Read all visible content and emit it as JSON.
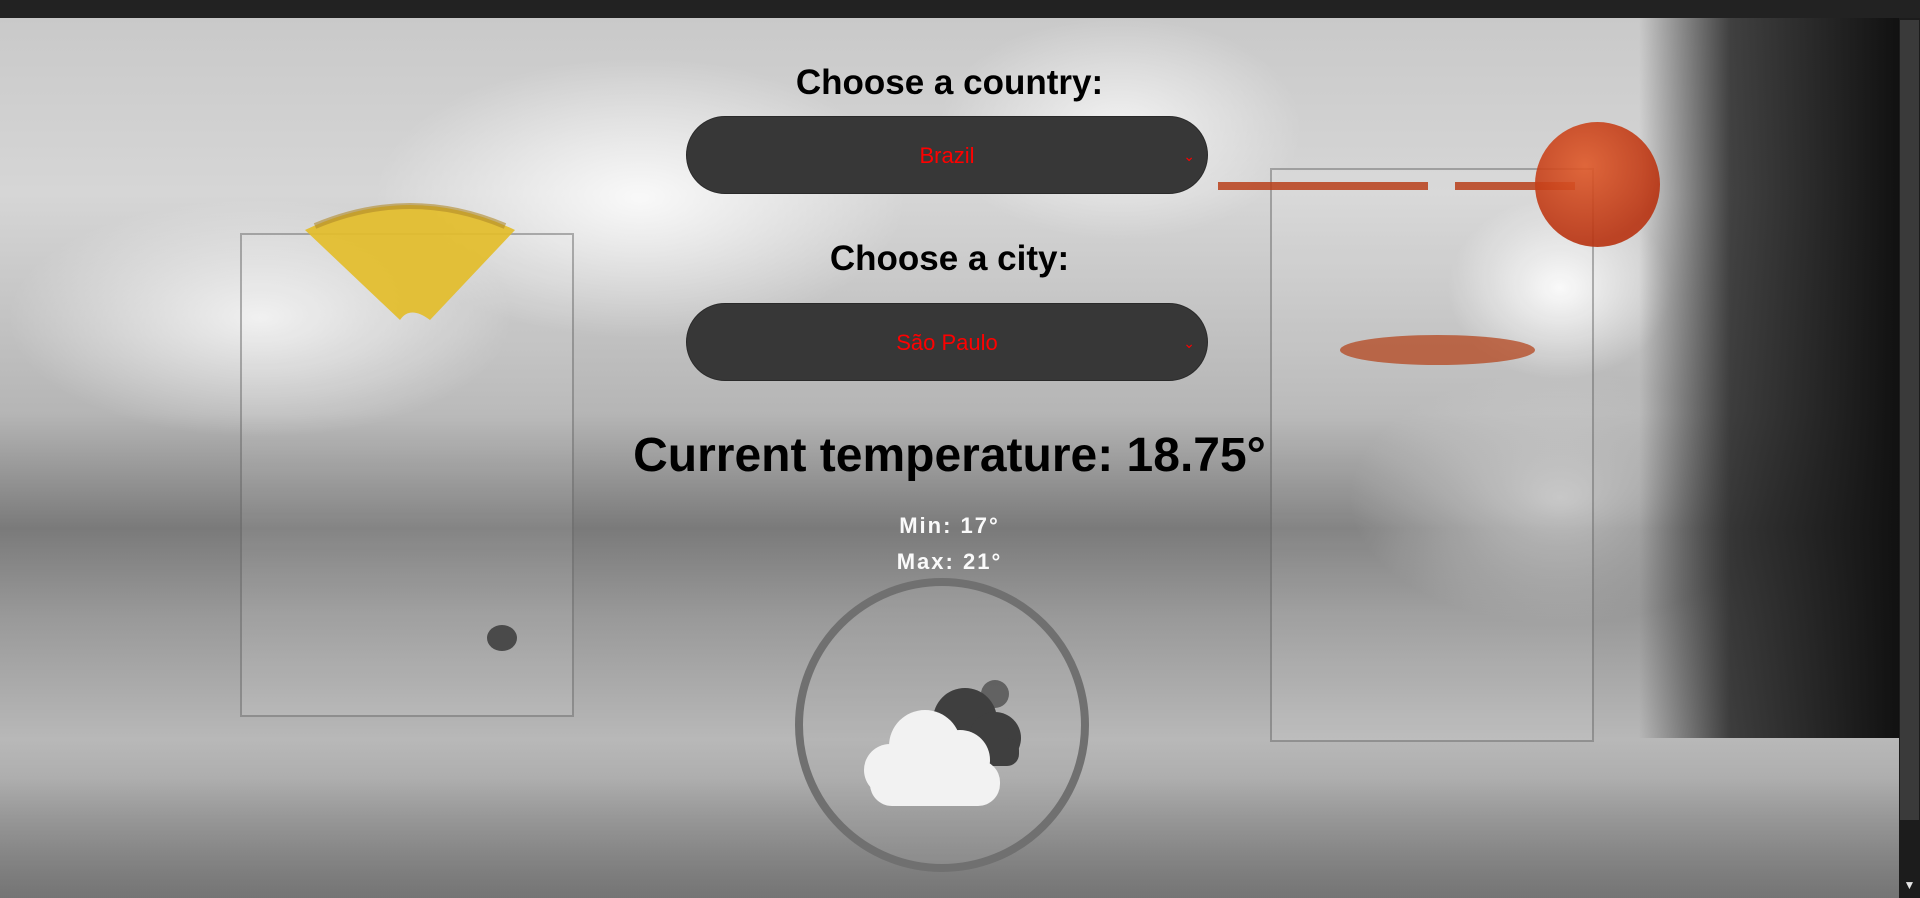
{
  "country": {
    "label": "Choose a country:",
    "selected": "Brazil"
  },
  "city": {
    "label": "Choose a city:",
    "selected": "São Paulo"
  },
  "temperature": {
    "current_text": "Current temperature: 18.75°",
    "min_text": "Min: 17°",
    "max_text": "Max: 21°"
  },
  "weather_icon": "partly-cloudy-icon",
  "colors": {
    "select_bg": "#373737",
    "select_text": "#ff0000",
    "heading": "#000000",
    "minmax_text": "#fafafa"
  }
}
